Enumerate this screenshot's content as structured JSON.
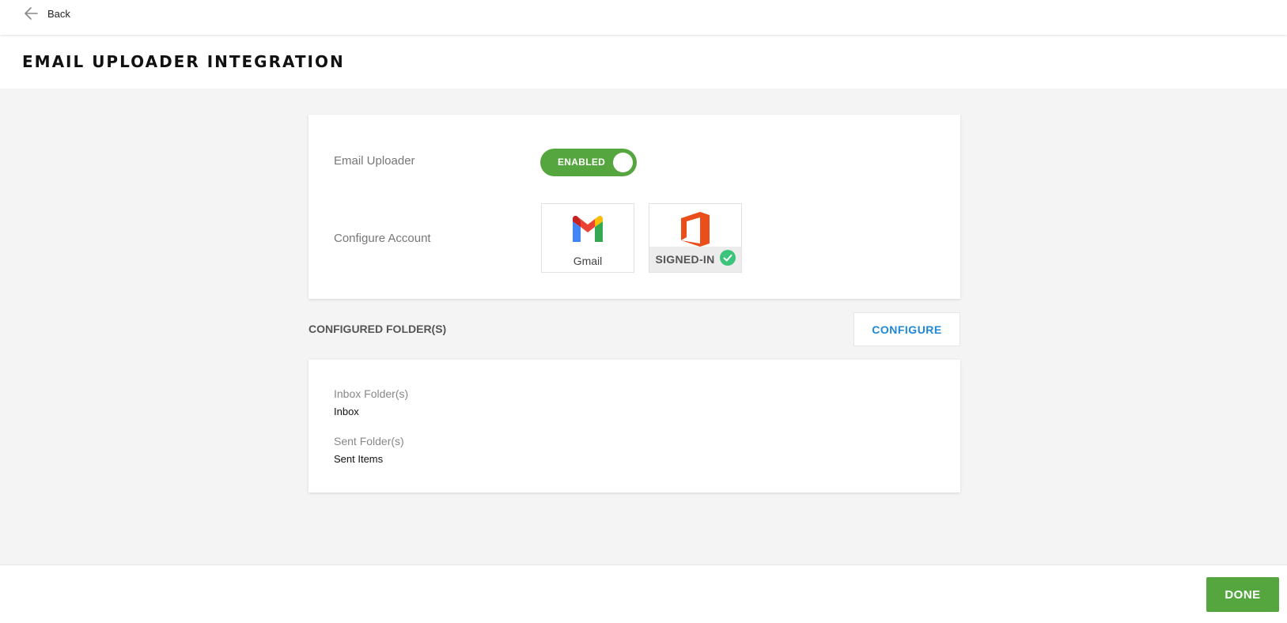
{
  "header": {
    "back_label": "Back",
    "back_icon": "arrow-left-icon"
  },
  "page": {
    "title": "EMAIL UPLOADER INTEGRATION"
  },
  "settings": {
    "email_uploader_label": "Email Uploader",
    "toggle_text": "ENABLED",
    "toggle_state": "on",
    "toggle_color": "#56a63f",
    "configure_account_label": "Configure Account",
    "accounts": [
      {
        "name": "Gmail",
        "icon": "gmail-icon",
        "signed_in": false
      },
      {
        "name": "Office 365",
        "icon": "office-icon",
        "signed_in": true,
        "status_text": "SIGNED-IN",
        "status_icon": "check-circle-icon"
      }
    ]
  },
  "folders": {
    "section_title": "CONFIGURED FOLDER(S)",
    "configure_label": "CONFIGURE",
    "configure_color": "#1e88d6",
    "inbox_label": "Inbox Folder(s)",
    "inbox_value": "Inbox",
    "sent_label": "Sent Folder(s)",
    "sent_value": "Sent Items"
  },
  "footer": {
    "done_label": "DONE",
    "done_color": "#56a63f"
  }
}
